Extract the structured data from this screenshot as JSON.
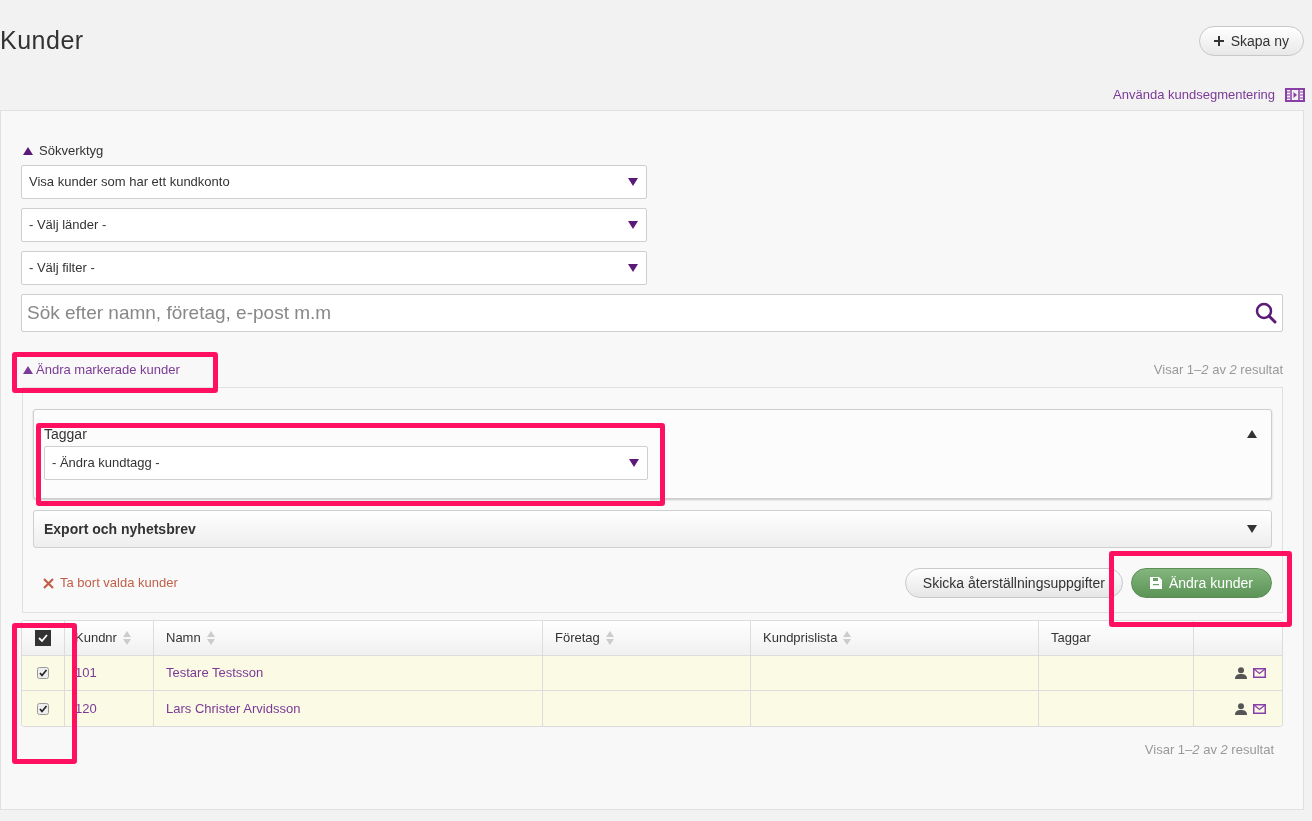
{
  "page": {
    "title": "Kunder",
    "create_button": "Skapa ny",
    "help_link": "Använda kundsegmentering"
  },
  "search_tools": {
    "label": "Sökverktyg",
    "expanded": true,
    "selects": [
      "Visa kunder som har ett kundkonto",
      "- Välj länder -",
      "- Välj filter -"
    ],
    "search": {
      "placeholder": "Sök efter namn, företag, e-post m.m"
    }
  },
  "bulk_edit": {
    "label": "Ändra markerade kunder",
    "expanded": true,
    "result_count": "Visar 1–*2* av *2* resultat",
    "sections": [
      {
        "title": "Taggar",
        "expanded": true,
        "select": "- Ändra kundtagg -"
      },
      {
        "title": "Export och nyhetsbrev",
        "expanded": false
      }
    ],
    "delete_link": "Ta bort valda kunder",
    "buttons": [
      {
        "label": "Skicka återställningsuppgifter",
        "kind": "secondary"
      },
      {
        "label": "Ändra kunder",
        "kind": "primary"
      }
    ]
  },
  "table": {
    "select_all": true,
    "columns": [
      {
        "label": "Kundnr",
        "sortable": true
      },
      {
        "label": "Namn",
        "sortable": true
      },
      {
        "label": "Företag",
        "sortable": true
      },
      {
        "label": "Kundprislista",
        "sortable": true
      },
      {
        "label": "Taggar",
        "sortable": false
      }
    ],
    "rows": [
      {
        "selected": true,
        "kundnr": "101",
        "namn": "Testare Testsson"
      },
      {
        "selected": true,
        "kundnr": "120",
        "namn": "Lars Christer Arvidsson"
      }
    ]
  },
  "result_count_bottom": "Visar 1–*2* av *2* resultat"
}
